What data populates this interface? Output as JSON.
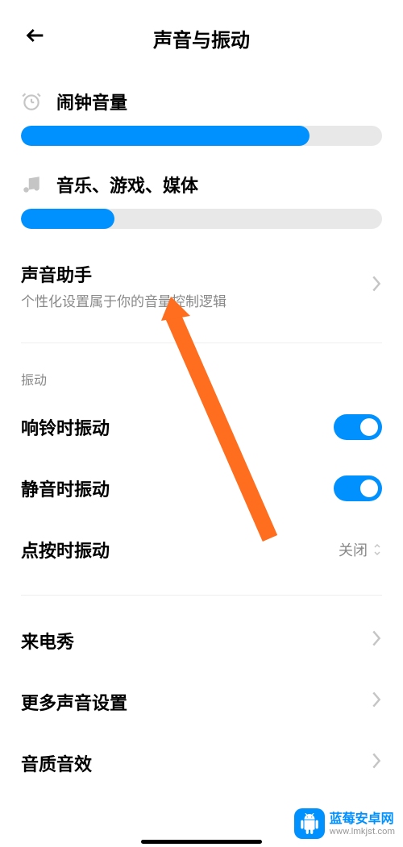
{
  "header": {
    "title": "声音与振动"
  },
  "volumes": {
    "alarm": {
      "label": "闹钟音量",
      "percent": 80
    },
    "media": {
      "label": "音乐、游戏、媒体",
      "percent": 26
    }
  },
  "soundAssistant": {
    "title": "声音助手",
    "subtitle": "个性化设置属于你的音量控制逻辑"
  },
  "vibrationGroup": {
    "label": "振动"
  },
  "toggles": {
    "vibrateOnRing": {
      "label": "响铃时振动",
      "on": true
    },
    "vibrateOnSilent": {
      "label": "静音时振动",
      "on": true
    },
    "vibrateOnTap": {
      "label": "点按时振动",
      "value": "关闭"
    }
  },
  "navItems": {
    "callerShow": {
      "label": "来电秀"
    },
    "moreSettings": {
      "label": "更多声音设置"
    },
    "soundEffects": {
      "label": "音质音效"
    }
  },
  "watermark": {
    "title": "蓝莓安卓网",
    "url": "www.lmkjst.com"
  }
}
